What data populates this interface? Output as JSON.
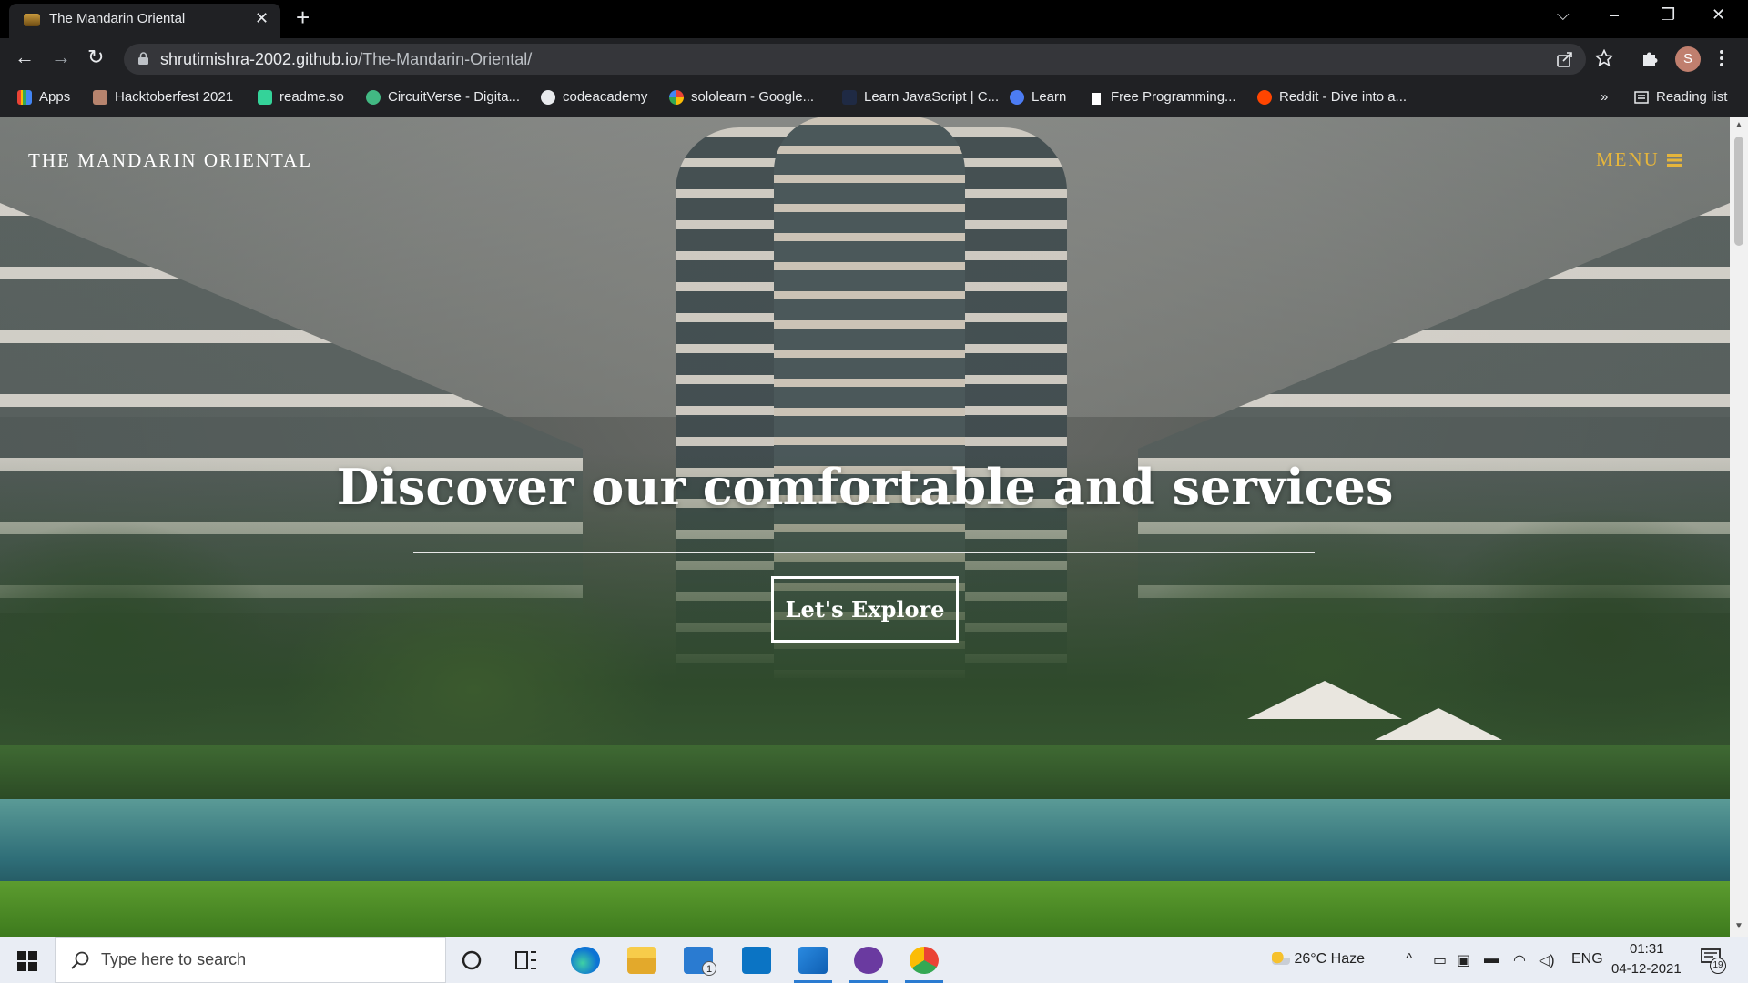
{
  "browser": {
    "tab": {
      "title": "The Mandarin Oriental",
      "close": "✕"
    },
    "new_tab": "+",
    "window_controls": {
      "tabsearch": "⌵",
      "minimize": "–",
      "maximize": "❐",
      "close": "✕"
    },
    "nav": {
      "back": "←",
      "forward": "→",
      "reload": "↻"
    },
    "address": {
      "host": "shrutimishra-2002.github.io",
      "path": "/The-Mandarin-Oriental/"
    },
    "avatar_letter": "S",
    "bookmarks": [
      {
        "label": "Apps",
        "icon": "apps-grid-icon",
        "color": "#ea4335"
      },
      {
        "label": "Hacktoberfest 2021",
        "icon": "hacktoberfest-icon",
        "color": "#b7846e"
      },
      {
        "label": "readme.so",
        "icon": "readme-icon",
        "color": "#34d399"
      },
      {
        "label": "CircuitVerse - Digita...",
        "icon": "circuitverse-icon",
        "color": "#42b983"
      },
      {
        "label": "codeacademy",
        "icon": "globe-icon",
        "color": "#e8eaed"
      },
      {
        "label": "sololearn - Google...",
        "icon": "google-icon",
        "color": "#4285f4"
      },
      {
        "label": "Learn JavaScript | C...",
        "icon": "codecademy-icon",
        "color": "#1f2a44"
      },
      {
        "label": "Learn",
        "icon": "learn-icon",
        "color": "#4c7cf3"
      },
      {
        "label": "Free Programming...",
        "icon": "freecodecamp-icon",
        "color": "#ffffff"
      },
      {
        "label": "Reddit - Dive into a...",
        "icon": "reddit-icon",
        "color": "#ff4500"
      }
    ],
    "bookmarks_overflow": "»",
    "reading_list": "Reading list"
  },
  "site": {
    "brand": "THE MANDARIN ORIENTAL",
    "menu_label": "MENU",
    "headline": "Discover our comfortable and services",
    "cta_label": "Let's Explore",
    "accent_color": "#e5b53c"
  },
  "taskbar": {
    "search_placeholder": "Type here to search",
    "mail_badge": "1",
    "weather": {
      "temp": "26°C",
      "condition": "Haze"
    },
    "language": "ENG",
    "time": "01:31",
    "date": "04-12-2021",
    "notification_count": "19"
  }
}
